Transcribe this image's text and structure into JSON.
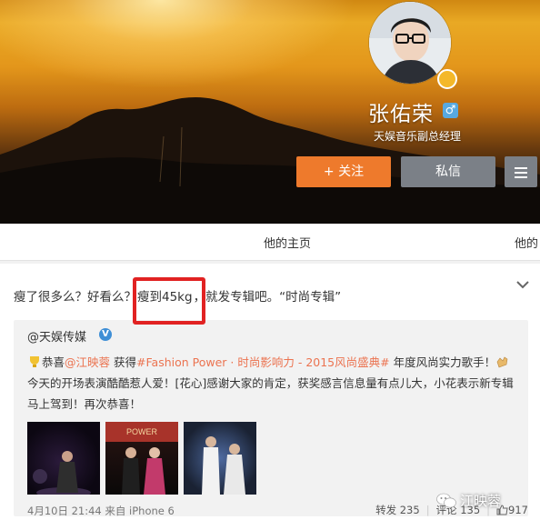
{
  "profile": {
    "name": "张佑荣",
    "gender_symbol": "♂",
    "title": "天娱音乐副总经理"
  },
  "actions": {
    "follow_label": "+ 关注",
    "message_label": "私信",
    "menu_icon": "hamburger-icon"
  },
  "tabs": {
    "home_label": "他的主页",
    "more_label": "他的"
  },
  "post": {
    "text_before": "瘦了很多么？好看么？",
    "text_highlight": "瘦到45kg",
    "text_after": "，就发专辑吧。“时尚专辑”",
    "repost": {
      "author": "@天娱传媒",
      "verified_symbol": "V",
      "body_part1": "恭喜",
      "mention": "@江映蓉",
      "body_part2": " 获得",
      "hashtag": "#Fashion Power · 时尚影响力 - 2015风尚盛典#",
      "body_part3": " 年度风尚实力歌手！",
      "body_part4": "今天的开场表演酷酷惹人爱！[花心]感谢大家的肯定，获奖感言信息量有点儿大，小花表示新专辑马上驾到！再次恭喜！"
    },
    "meta": "4月10日 21:44 来自 iPhone 6",
    "repost_count": "转发 235",
    "comment_count": "评论 135",
    "like_count": "917"
  },
  "watermark": {
    "text": "江映蓉",
    "icon": "wechat-icon"
  },
  "colors": {
    "follow": "#ee7a2c",
    "secondary_button": "#7b8087",
    "link": "#eb7350",
    "highlight_box": "#e12222",
    "verified": "#3f8fd6"
  }
}
